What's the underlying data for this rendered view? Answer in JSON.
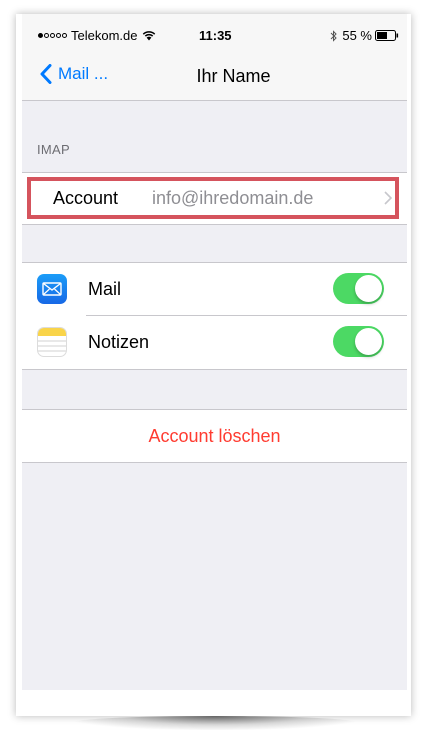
{
  "status_bar": {
    "carrier": "Telekom.de",
    "signal_bars": 1,
    "time": "11:35",
    "battery": "55 %"
  },
  "nav": {
    "back_label": "Mail ...",
    "title": "Ihr Name"
  },
  "imap_section": {
    "header": "IMAP",
    "account_label": "Account",
    "account_value": "info@ihredomain.de"
  },
  "apps": [
    {
      "label": "Mail",
      "icon": "mail-icon",
      "enabled": true
    },
    {
      "label": "Notizen",
      "icon": "notes-icon",
      "enabled": true
    }
  ],
  "delete_label": "Account löschen",
  "colors": {
    "tint": "#007aff",
    "toggle_on": "#4cd964",
    "destructive": "#ff3b30",
    "highlight_box": "#d5545d"
  }
}
